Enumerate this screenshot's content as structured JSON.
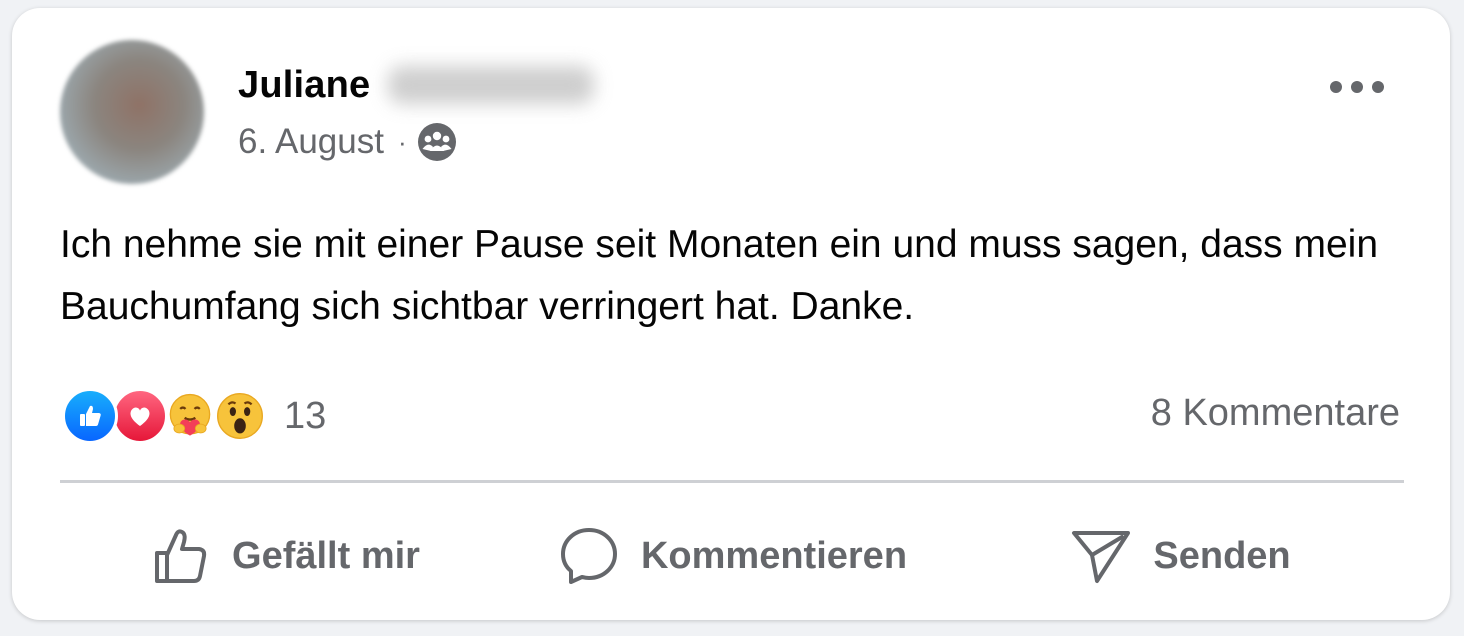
{
  "post": {
    "author_first_name": "Juliane",
    "date": "6. August",
    "meta_separator": "·",
    "audience_icon": "group-audience-icon",
    "more_icon": "more-options-icon",
    "text": "Ich nehme sie mit einer Pause seit Monaten ein und muss sagen, dass mein Bauchumfang sich sichtbar verringert hat. Danke.",
    "reactions": {
      "types": [
        "like",
        "love",
        "care",
        "wow"
      ],
      "count": "13"
    },
    "comments_label": "8 Kommentare",
    "actions": {
      "like_label": "Gefällt mir",
      "comment_label": "Kommentieren",
      "share_label": "Senden"
    }
  },
  "colors": {
    "like_blue": "#0866ff",
    "love_red": "#e61739",
    "secondary_text": "#65676b",
    "primary_text": "#050505",
    "divider": "#ced0d4"
  }
}
